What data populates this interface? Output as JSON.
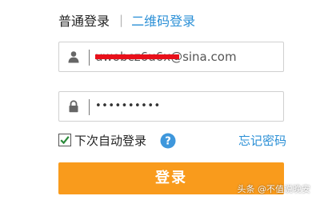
{
  "tabs": {
    "normal_login": "普通登录",
    "separator": "|",
    "qr_login": "二维码登录"
  },
  "username": {
    "value": "uwobcz6u6x@sina.com",
    "icon": "user-icon"
  },
  "password": {
    "value": "••••••••••",
    "icon": "lock-icon"
  },
  "remember": {
    "label": "下次自动登录",
    "checked": true,
    "help_icon": "help-icon"
  },
  "forgot_password": "忘记密码",
  "login_button": "登录",
  "watermark": "头条 @不值说晚安",
  "colors": {
    "accent": "#f99b1c",
    "link": "#2a8fd6",
    "redaction": "#e8101a",
    "checkmark": "#2a8a3a"
  }
}
